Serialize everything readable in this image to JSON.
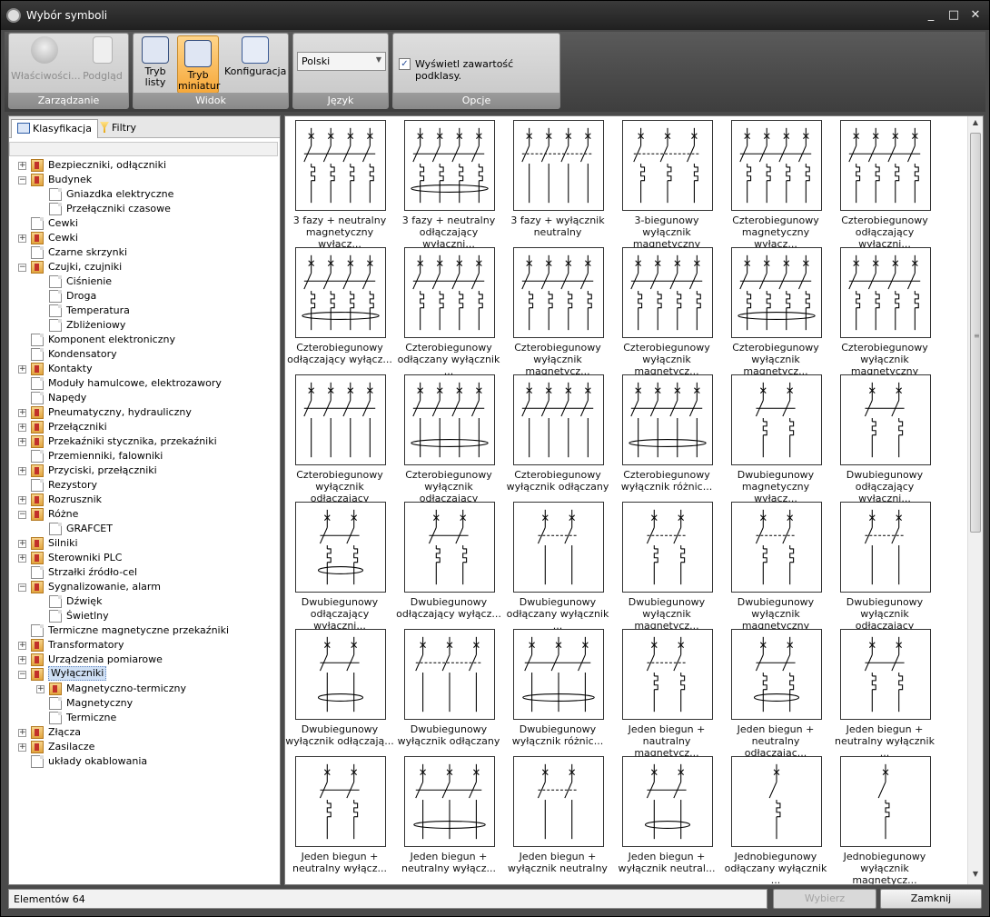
{
  "window": {
    "title": "Wybór symboli",
    "controls": [
      "_",
      "□",
      "✕"
    ]
  },
  "ribbon": {
    "groups": [
      {
        "label": "Zarządzanie",
        "buttons": [
          {
            "label": "Właściwości...",
            "icon": "info-icon",
            "enabled": false
          },
          {
            "label": "Podgląd",
            "icon": "preview-page-icon",
            "enabled": false
          }
        ]
      },
      {
        "label": "Widok",
        "buttons": [
          {
            "label": "Tryb listy",
            "line1": "Tryb",
            "line2": "listy",
            "icon": "list-view-icon",
            "active": false
          },
          {
            "label": "Tryb miniatur",
            "line1": "Tryb",
            "line2": "miniatur",
            "icon": "thumbnail-view-icon",
            "active": true
          },
          {
            "label": "Konfiguracja",
            "icon": "configuration-icon"
          }
        ]
      },
      {
        "label": "Język",
        "select_value": "Polski"
      },
      {
        "label": "Opcje",
        "checkbox_label": "Wyświetl zawartość podklasy.",
        "checked": true
      }
    ]
  },
  "left_panel": {
    "tabs": [
      {
        "label": "Klasyfikacja",
        "icon": "classification-tree-icon",
        "active": true
      },
      {
        "label": "Filtry",
        "icon": "filter-funnel-icon",
        "active": false
      }
    ],
    "tree": [
      {
        "label": "Bezpieczniki, odłączniki",
        "level": 0,
        "type": "folder",
        "expander": "+"
      },
      {
        "label": "Budynek",
        "level": 0,
        "type": "folder",
        "expander": "−"
      },
      {
        "label": "Gniazdka elektryczne",
        "level": 1,
        "type": "doc"
      },
      {
        "label": "Przełączniki czasowe",
        "level": 1,
        "type": "doc"
      },
      {
        "label": "Cewki",
        "level": 0,
        "type": "doc"
      },
      {
        "label": "Cewki",
        "level": 0,
        "type": "folder",
        "expander": "+"
      },
      {
        "label": "Czarne skrzynki",
        "level": 0,
        "type": "doc"
      },
      {
        "label": "Czujki, czujniki",
        "level": 0,
        "type": "folder",
        "expander": "−"
      },
      {
        "label": "Ciśnienie",
        "level": 1,
        "type": "doc"
      },
      {
        "label": "Droga",
        "level": 1,
        "type": "doc"
      },
      {
        "label": "Temperatura",
        "level": 1,
        "type": "doc"
      },
      {
        "label": "Zbliżeniowy",
        "level": 1,
        "type": "doc"
      },
      {
        "label": "Komponent elektroniczny",
        "level": 0,
        "type": "doc"
      },
      {
        "label": "Kondensatory",
        "level": 0,
        "type": "doc"
      },
      {
        "label": "Kontakty",
        "level": 0,
        "type": "folder",
        "expander": "+"
      },
      {
        "label": "Moduły hamulcowe, elektrozawory",
        "level": 0,
        "type": "doc"
      },
      {
        "label": "Napędy",
        "level": 0,
        "type": "doc"
      },
      {
        "label": "Pneumatyczny, hydrauliczny",
        "level": 0,
        "type": "folder",
        "expander": "+"
      },
      {
        "label": "Przełączniki",
        "level": 0,
        "type": "folder",
        "expander": "+"
      },
      {
        "label": "Przekaźniki stycznika, przekaźniki",
        "level": 0,
        "type": "folder",
        "expander": "+"
      },
      {
        "label": "Przemienniki, falowniki",
        "level": 0,
        "type": "doc"
      },
      {
        "label": "Przyciski, przełączniki",
        "level": 0,
        "type": "folder",
        "expander": "+"
      },
      {
        "label": "Rezystory",
        "level": 0,
        "type": "doc"
      },
      {
        "label": "Rozrusznik",
        "level": 0,
        "type": "folder",
        "expander": "+"
      },
      {
        "label": "Różne",
        "level": 0,
        "type": "folder",
        "expander": "−"
      },
      {
        "label": "GRAFCET",
        "level": 1,
        "type": "doc"
      },
      {
        "label": "Silniki",
        "level": 0,
        "type": "folder",
        "expander": "+"
      },
      {
        "label": "Sterowniki PLC",
        "level": 0,
        "type": "folder",
        "expander": "+"
      },
      {
        "label": "Strzałki źródło-cel",
        "level": 0,
        "type": "doc"
      },
      {
        "label": "Sygnalizowanie, alarm",
        "level": 0,
        "type": "folder",
        "expander": "−"
      },
      {
        "label": "Dźwięk",
        "level": 1,
        "type": "doc"
      },
      {
        "label": "Świetlny",
        "level": 1,
        "type": "doc"
      },
      {
        "label": "Termiczne magnetyczne przekaźniki",
        "level": 0,
        "type": "doc"
      },
      {
        "label": "Transformatory",
        "level": 0,
        "type": "folder",
        "expander": "+"
      },
      {
        "label": "Urządzenia pomiarowe",
        "level": 0,
        "type": "folder",
        "expander": "+"
      },
      {
        "label": "Wyłączniki",
        "level": 0,
        "type": "folder",
        "expander": "−",
        "selected": true
      },
      {
        "label": "Magnetyczno-termiczny",
        "level": 1,
        "type": "folder",
        "expander": "+"
      },
      {
        "label": "Magnetyczny",
        "level": 1,
        "type": "doc"
      },
      {
        "label": "Termiczne",
        "level": 1,
        "type": "doc"
      },
      {
        "label": "Złącza",
        "level": 0,
        "type": "folder",
        "expander": "+"
      },
      {
        "label": "Zasilacze",
        "level": 0,
        "type": "folder",
        "expander": "+"
      },
      {
        "label": "układy okablowania",
        "level": 0,
        "type": "doc"
      }
    ]
  },
  "symbols": [
    {
      "line1": "3 fazy + neutralny",
      "line2": "magnetyczny wyłącz...",
      "poles": 4,
      "coil": "mag",
      "tie": "none"
    },
    {
      "line1": "3 fazy + neutralny",
      "line2": "odłączający wyłączni...",
      "poles": 4,
      "coil": "mag",
      "tie": "ellipse"
    },
    {
      "line1": "3 fazy + wyłącznik",
      "line2": "neutralny",
      "poles": 4,
      "coil": "none",
      "tie": "dash"
    },
    {
      "line1": "3-biegunowy wyłącznik",
      "line2": "magnetyczny",
      "poles": 3,
      "coil": "mag",
      "tie": "dash"
    },
    {
      "line1": "Czterobiegunowy",
      "line2": "magnetyczny wyłącz...",
      "poles": 4,
      "coil": "mag",
      "tie": "none"
    },
    {
      "line1": "Czterobiegunowy",
      "line2": "odłączający wyłączni...",
      "poles": 4,
      "coil": "mag",
      "tie": "none"
    },
    {
      "line1": "Czterobiegunowy",
      "line2": "odłączający wyłącz...",
      "poles": 4,
      "coil": "mag",
      "tie": "ellipse"
    },
    {
      "line1": "Czterobiegunowy",
      "line2": "odłączany wyłącznik ...",
      "poles": 4,
      "coil": "mag",
      "tie": "none"
    },
    {
      "line1": "Czterobiegunowy",
      "line2": "wyłącznik magnetycz...",
      "poles": 4,
      "coil": "mag",
      "tie": "none"
    },
    {
      "line1": "Czterobiegunowy",
      "line2": "wyłącznik magnetycz...",
      "poles": 4,
      "coil": "mag",
      "tie": "none"
    },
    {
      "line1": "Czterobiegunowy",
      "line2": "wyłącznik magnetycz...",
      "poles": 4,
      "coil": "mag",
      "tie": "ellipse"
    },
    {
      "line1": "Czterobiegunowy",
      "line2": "wyłącznik magnetyczny",
      "poles": 4,
      "coil": "mag",
      "tie": "none"
    },
    {
      "line1": "Czterobiegunowy",
      "line2": "wyłącznik odłączający",
      "poles": 4,
      "coil": "none",
      "tie": "none"
    },
    {
      "line1": "Czterobiegunowy",
      "line2": "wyłącznik odłączający",
      "poles": 4,
      "coil": "none",
      "tie": "ellipse"
    },
    {
      "line1": "Czterobiegunowy",
      "line2": "wyłącznik odłączany",
      "poles": 4,
      "coil": "none",
      "tie": "none"
    },
    {
      "line1": "Czterobiegunowy",
      "line2": "wyłącznik różnic...",
      "poles": 4,
      "coil": "none",
      "tie": "ellipse"
    },
    {
      "line1": "Dwubiegunowy",
      "line2": "magnetyczny wyłącz...",
      "poles": 2,
      "coil": "mag",
      "tie": "none"
    },
    {
      "line1": "Dwubiegunowy",
      "line2": "odłączający wyłączni...",
      "poles": 2,
      "coil": "mag",
      "tie": "none"
    },
    {
      "line1": "Dwubiegunowy",
      "line2": "odłączający wyłączni...",
      "poles": 2,
      "coil": "mag",
      "tie": "ellipse"
    },
    {
      "line1": "Dwubiegunowy",
      "line2": "odłączający wyłącz...",
      "poles": 2,
      "coil": "mag",
      "tie": "none"
    },
    {
      "line1": "Dwubiegunowy",
      "line2": "odłączany wyłącznik ...",
      "poles": 2,
      "coil": "none",
      "tie": "dash"
    },
    {
      "line1": "Dwubiegunowy",
      "line2": "wyłącznik magnetycz...",
      "poles": 2,
      "coil": "mag",
      "tie": "dash"
    },
    {
      "line1": "Dwubiegunowy",
      "line2": "wyłącznik magnetyczny",
      "poles": 2,
      "coil": "mag",
      "tie": "dash"
    },
    {
      "line1": "Dwubiegunowy",
      "line2": "wyłącznik odłączający",
      "poles": 2,
      "coil": "none",
      "tie": "dash"
    },
    {
      "line1": "Dwubiegunowy",
      "line2": "wyłącznik odłączają...",
      "poles": 2,
      "coil": "none",
      "tie": "ellipse"
    },
    {
      "line1": "Dwubiegunowy",
      "line2": "wyłącznik odłączany",
      "poles": 3,
      "coil": "none",
      "tie": "dash"
    },
    {
      "line1": "Dwubiegunowy",
      "line2": "wyłącznik różnic...",
      "poles": 3,
      "coil": "none",
      "tie": "ellipse"
    },
    {
      "line1": "Jeden biegun +",
      "line2": "nautralny magnetycz...",
      "poles": 2,
      "coil": "mag",
      "tie": "dash"
    },
    {
      "line1": "Jeden biegun +",
      "line2": "neutralny odłączając...",
      "poles": 2,
      "coil": "mag",
      "tie": "ellipse"
    },
    {
      "line1": "Jeden biegun +",
      "line2": "neutralny wyłącznik ...",
      "poles": 2,
      "coil": "mag",
      "tie": "none"
    },
    {
      "line1": "Jeden biegun +",
      "line2": "neutralny wyłącz...",
      "poles": 2,
      "coil": "mag",
      "tie": "none"
    },
    {
      "line1": "Jeden biegun +",
      "line2": "neutralny wyłącz...",
      "poles": 3,
      "coil": "none",
      "tie": "ellipse"
    },
    {
      "line1": "Jeden biegun +",
      "line2": "wyłącznik neutralny",
      "poles": 2,
      "coil": "none",
      "tie": "dash"
    },
    {
      "line1": "Jeden biegun +",
      "line2": "wyłącznik neutral...",
      "poles": 2,
      "coil": "none",
      "tie": "ellipse"
    },
    {
      "line1": "Jednobiegunowy",
      "line2": "odłączany wyłącznik ...",
      "poles": 1,
      "coil": "mag",
      "tie": "none"
    },
    {
      "line1": "Jednobiegunowy",
      "line2": "wyłącznik magnetycz...",
      "poles": 1,
      "coil": "mag",
      "tie": "none"
    }
  ],
  "statusbar": {
    "count_text": "Elementów 64",
    "select_label": "Wybierz",
    "close_label": "Zamknij"
  }
}
